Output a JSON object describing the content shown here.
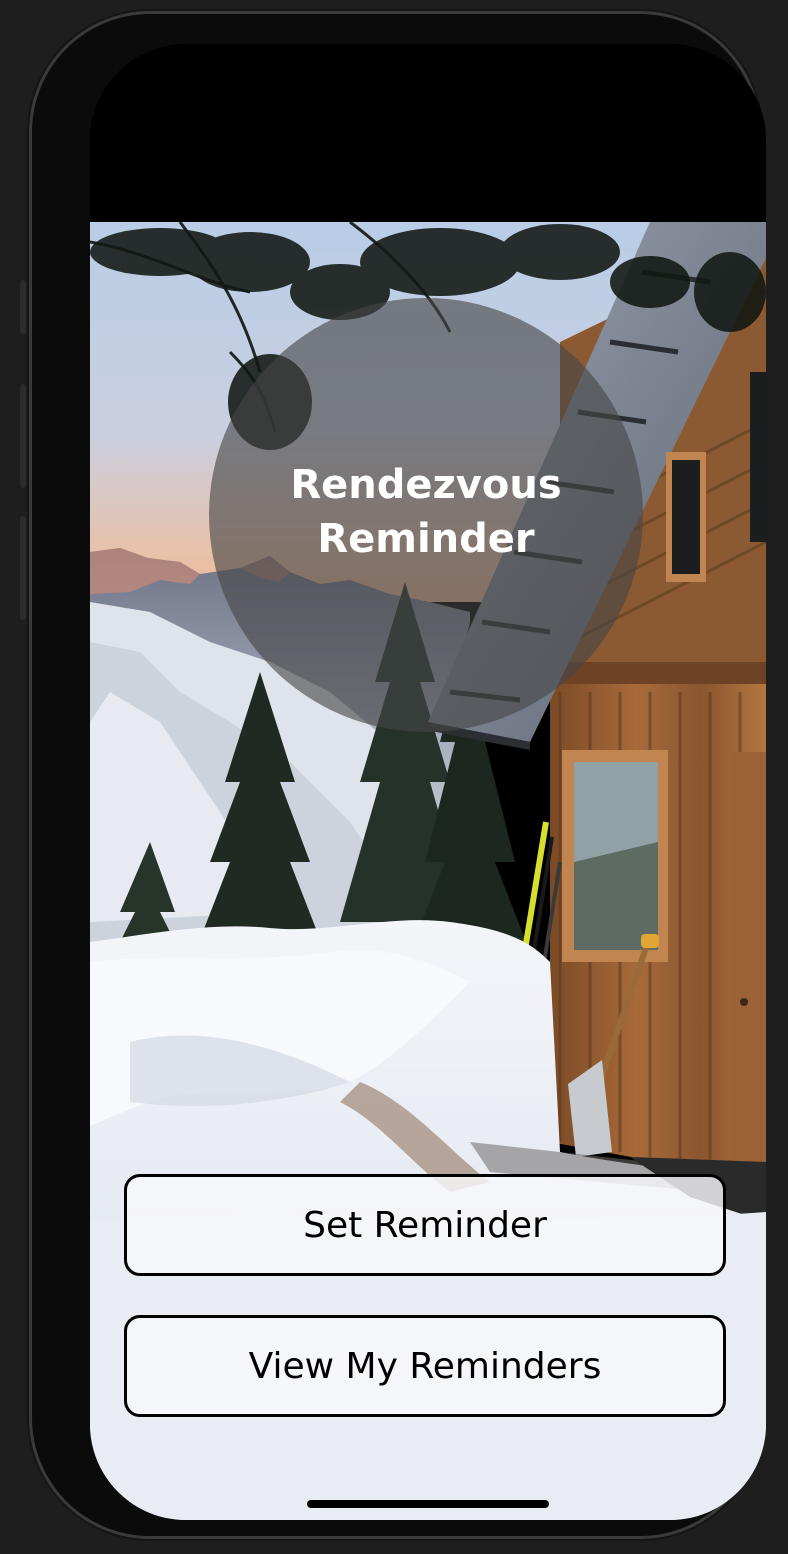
{
  "app": {
    "title_line1": "Rendezvous",
    "title_line2": "Reminder"
  },
  "actions": {
    "set_reminder_label": "Set Reminder",
    "view_reminders_label": "View My Reminders"
  },
  "background": {
    "image_subject": "mountain-cabin-snow-photo"
  },
  "colors": {
    "button_border": "#000000",
    "button_fill": "#f8f8fa",
    "title_text": "#ffffff",
    "title_circle": "#464646"
  }
}
